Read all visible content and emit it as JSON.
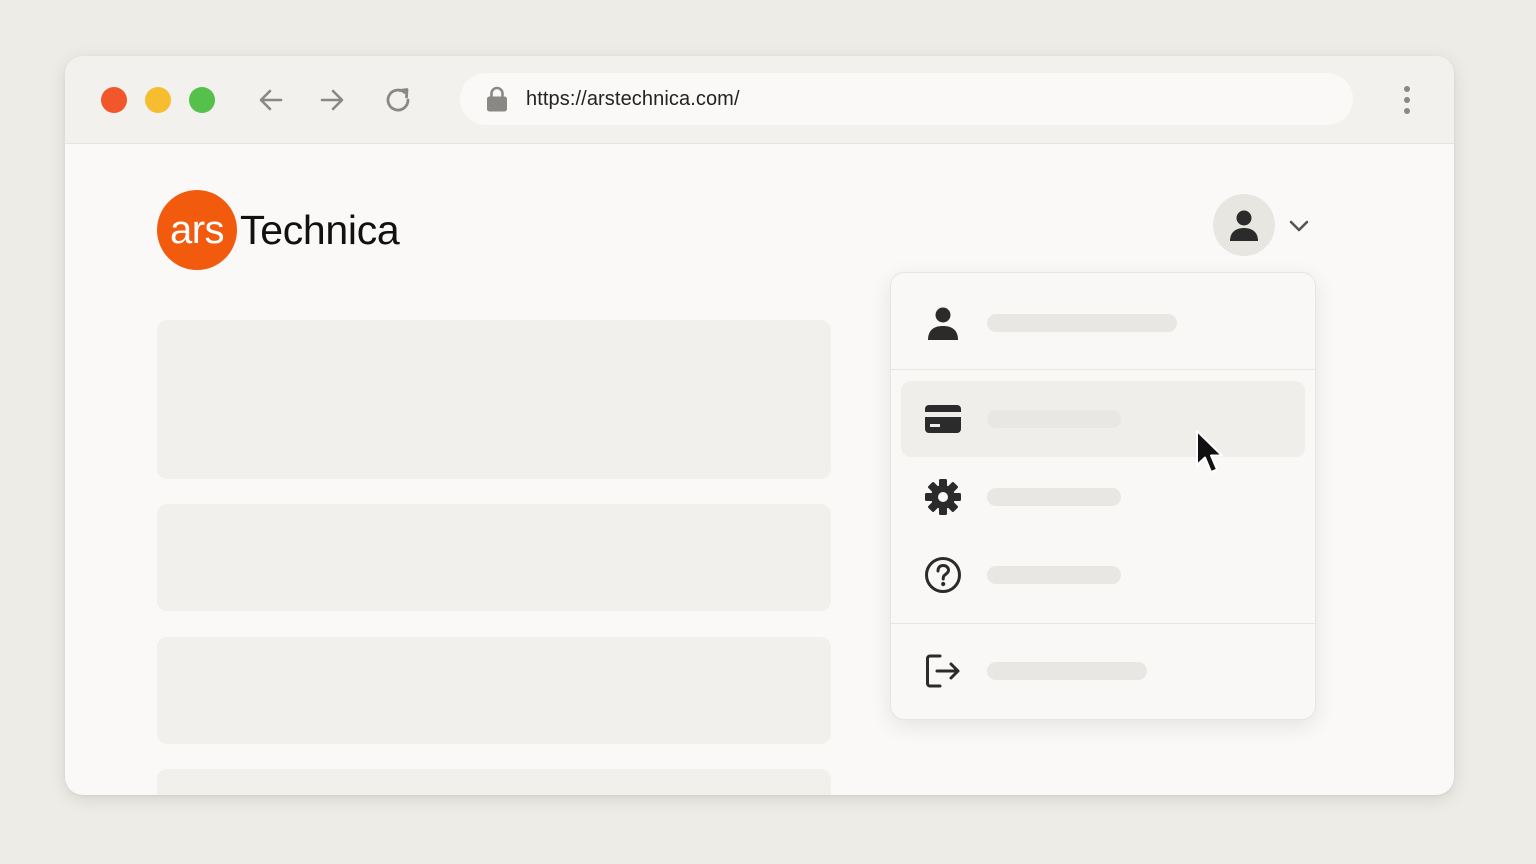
{
  "browser": {
    "url": "https://arstechnica.com/",
    "colors": {
      "close": "#f2572b",
      "minimize": "#f6bd30",
      "maximize": "#55c04a"
    },
    "icons": {
      "back": "arrow-left-icon",
      "forward": "arrow-right-icon",
      "reload": "reload-icon",
      "lock": "lock-icon",
      "more": "more-vertical-icon"
    }
  },
  "site": {
    "logo_badge": "ars",
    "logo_word": "Technica",
    "brand_color": "#f25a0e"
  },
  "account_menu": {
    "trigger_icon": "user-icon",
    "chevron_icon": "chevron-down-icon",
    "items": [
      {
        "icon": "user-icon"
      },
      {
        "icon": "credit-card-icon",
        "hovered": true
      },
      {
        "icon": "gear-icon"
      },
      {
        "icon": "help-circle-icon"
      },
      {
        "icon": "logout-icon"
      }
    ]
  }
}
